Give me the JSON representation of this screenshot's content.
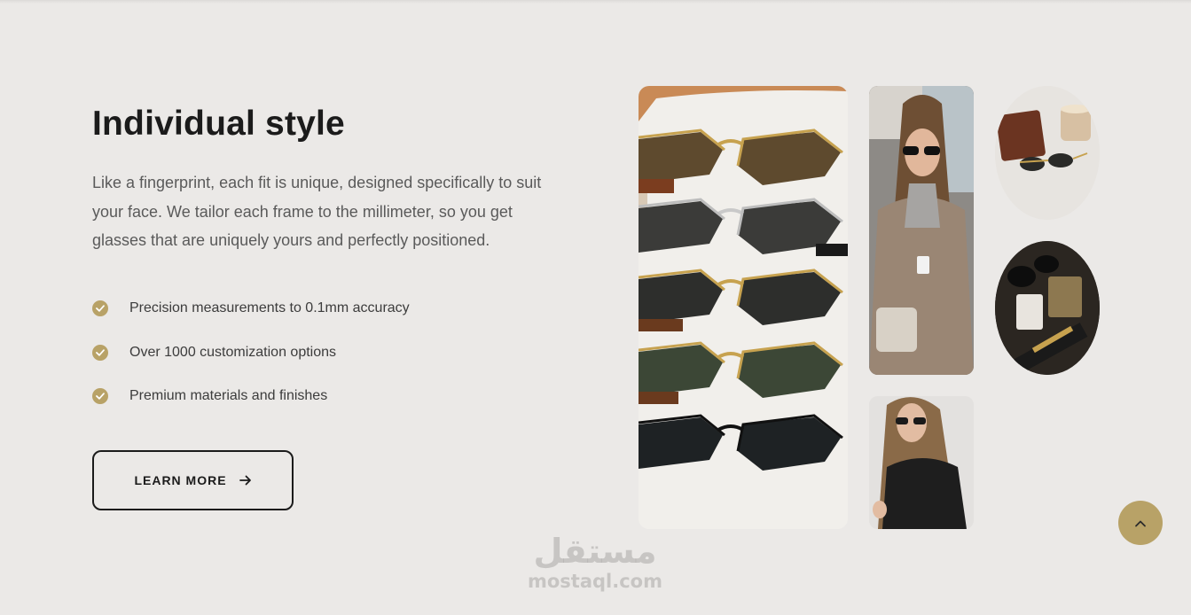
{
  "section": {
    "title": "Individual style",
    "description": "Like a fingerprint, each fit is unique, designed specifically to suit your face. We tailor each frame to the millimeter, so you get glasses that are uniquely yours and perfectly positioned.",
    "features": [
      {
        "label": "Precision measurements to 0.1mm accuracy",
        "icon": "check-circle-icon"
      },
      {
        "label": "Over 1000 customization options",
        "icon": "check-circle-icon"
      },
      {
        "label": "Premium materials and finishes",
        "icon": "check-circle-icon"
      }
    ],
    "cta_label": "LEARN MORE",
    "cta_icon": "arrow-right-icon"
  },
  "gallery": {
    "images": [
      {
        "name": "sunglasses-stack-photo"
      },
      {
        "name": "woman-fur-coat-photo"
      },
      {
        "name": "woman-leather-jacket-photo"
      },
      {
        "name": "sunglasses-case-photo"
      },
      {
        "name": "sunglasses-perfume-photo"
      }
    ]
  },
  "scroll_top": {
    "icon": "chevron-up-icon"
  },
  "watermark": {
    "arabic": "مستقل",
    "latin": "mostaql.com"
  },
  "colors": {
    "background": "#ebe9e7",
    "accent_gold": "#b8a267",
    "heading": "#1b1b1b",
    "body_text": "#5a5a5a"
  }
}
